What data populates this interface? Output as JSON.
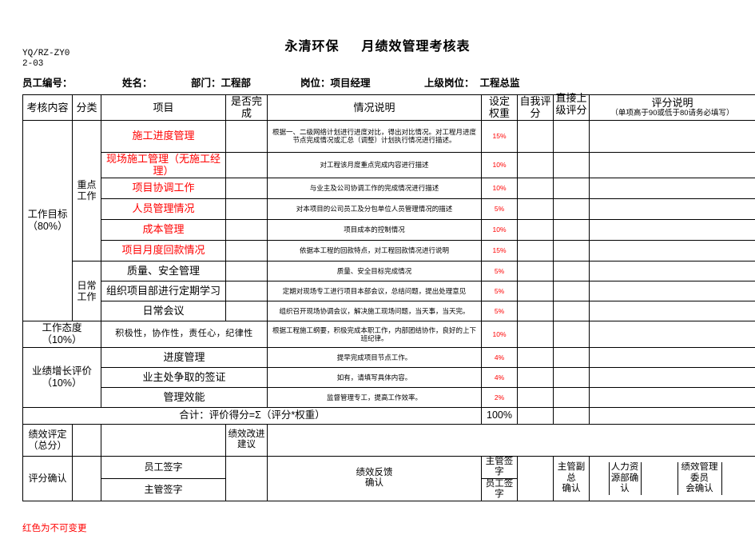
{
  "document": {
    "code": "YQ/RZ-ZY02-03",
    "company": "永清环保",
    "title": "月绩效管理考核表",
    "footnote": "红色为不可变更"
  },
  "info_fields": [
    {
      "label": "员工编号：",
      "value": ""
    },
    {
      "label": "姓名：",
      "value": ""
    },
    {
      "label": "部门：",
      "value": "工程部"
    },
    {
      "label": "岗位：",
      "value": "项目经理"
    },
    {
      "label": "上级岗位：",
      "value": "工程总监"
    }
  ],
  "columns": {
    "content": "考核内容",
    "category": "分类",
    "project": "项目",
    "completed": "是否完成",
    "description": "情况说明",
    "weight_l1": "设定",
    "weight_l2": "权重",
    "self_l1": "自我评",
    "self_l2": "分",
    "supervisor": "直接上级评分",
    "remark_title": "评分说明",
    "remark_sub": "（单项高于90或低于80请务必填写）"
  },
  "sections": {
    "work_goal": "工作目标（80%）",
    "work_goal_l1": "工作目标",
    "work_goal_l2": "（80%）",
    "key_work": "重点工作",
    "key_work_l1": "重点",
    "key_work_l2": "工作",
    "daily_work_l1": "日常",
    "daily_work_l2": "工作",
    "attitude_l1": "工作态度",
    "attitude_l2": "（10%）",
    "growth_l1": "业绩增长评价",
    "growth_l2": "（10%）"
  },
  "rows": [
    {
      "project": "施工进度管理",
      "project_color": "red",
      "description": "根据一、二级网络计划进行进度对比，得出对比情况。对工程月进度节点完成情况或汇总（调整）计划执行情况进行描述。",
      "weight": "15%"
    },
    {
      "project": "现场施工管理（无施工经理）",
      "project_color": "red",
      "description": "对工程该月度重点完成内容进行描述",
      "weight": "10%"
    },
    {
      "project": "项目协调工作",
      "project_color": "red",
      "description": "与业主及公司协调工作的完成情况进行描述",
      "weight": "10%"
    },
    {
      "project": "人员管理情况",
      "project_color": "red",
      "description": "对本项目的公司员工及分包单位人员管理情况的描述",
      "weight": "5%"
    },
    {
      "project": "成本管理",
      "project_color": "red",
      "description": "项目成本的控制情况",
      "weight": "10%"
    },
    {
      "project": "项目月度回款情况",
      "project_color": "red",
      "description": "依据本工程的回款特点，对工程回款情况进行说明",
      "weight": "15%"
    },
    {
      "project": "质量、安全管理",
      "project_color": "black",
      "description": "质量、安全目标完成情况",
      "weight": "5%"
    },
    {
      "project": "组织项目部进行定期学习",
      "project_color": "black",
      "description": "定期对现场专工进行项目本部会议，总结问题，提出处理意见",
      "weight": "5%"
    },
    {
      "project": "日常会议",
      "project_color": "black",
      "description": "组织召开现场协调会议，解决施工现场问题，当天事，当天完。",
      "weight": "5%"
    },
    {
      "project": "积极性，协作性，责任心，纪律性",
      "project_color": "black",
      "description": "根据工程施工纲要，积极完成本职工作，内部团结协作，良好的上下班纪律。",
      "weight": "10%"
    },
    {
      "project": "进度管理",
      "project_color": "black",
      "description": "提早完成项目节点工作。",
      "weight": "4%"
    },
    {
      "project": "业主处争取的签证",
      "project_color": "black",
      "description": "如有，请填写具体内容。",
      "weight": "4%"
    },
    {
      "project": "管理效能",
      "project_color": "black",
      "description": "监督管理专工，提高工作效率。",
      "weight": "2%"
    }
  ],
  "total": {
    "label": "合计：评价得分=Σ（评分*权重）",
    "weight": "100%"
  },
  "footer": {
    "evaluation_l1": "绩效评定",
    "evaluation_l2": "（总分）",
    "improve_l1": "绩效改进",
    "improve_l2": "建议",
    "confirm": "评分确认",
    "employee_sign": "员工签字",
    "manager_sign": "主管签字",
    "feedback_l1": "绩效反馈",
    "feedback_l2": "确认",
    "sup_sign": "主管签字",
    "emp_sign": "员工签字",
    "vp_l1": "主管副总",
    "vp_l2": "确认",
    "hr_l1": "人力资",
    "hr_l2": "源部确",
    "hr_l3": "认",
    "committee_l1": "绩效管理委员",
    "committee_l2": "会确认"
  },
  "colors": {
    "red": "#ff0000",
    "black": "#000000",
    "border": "#000000"
  }
}
